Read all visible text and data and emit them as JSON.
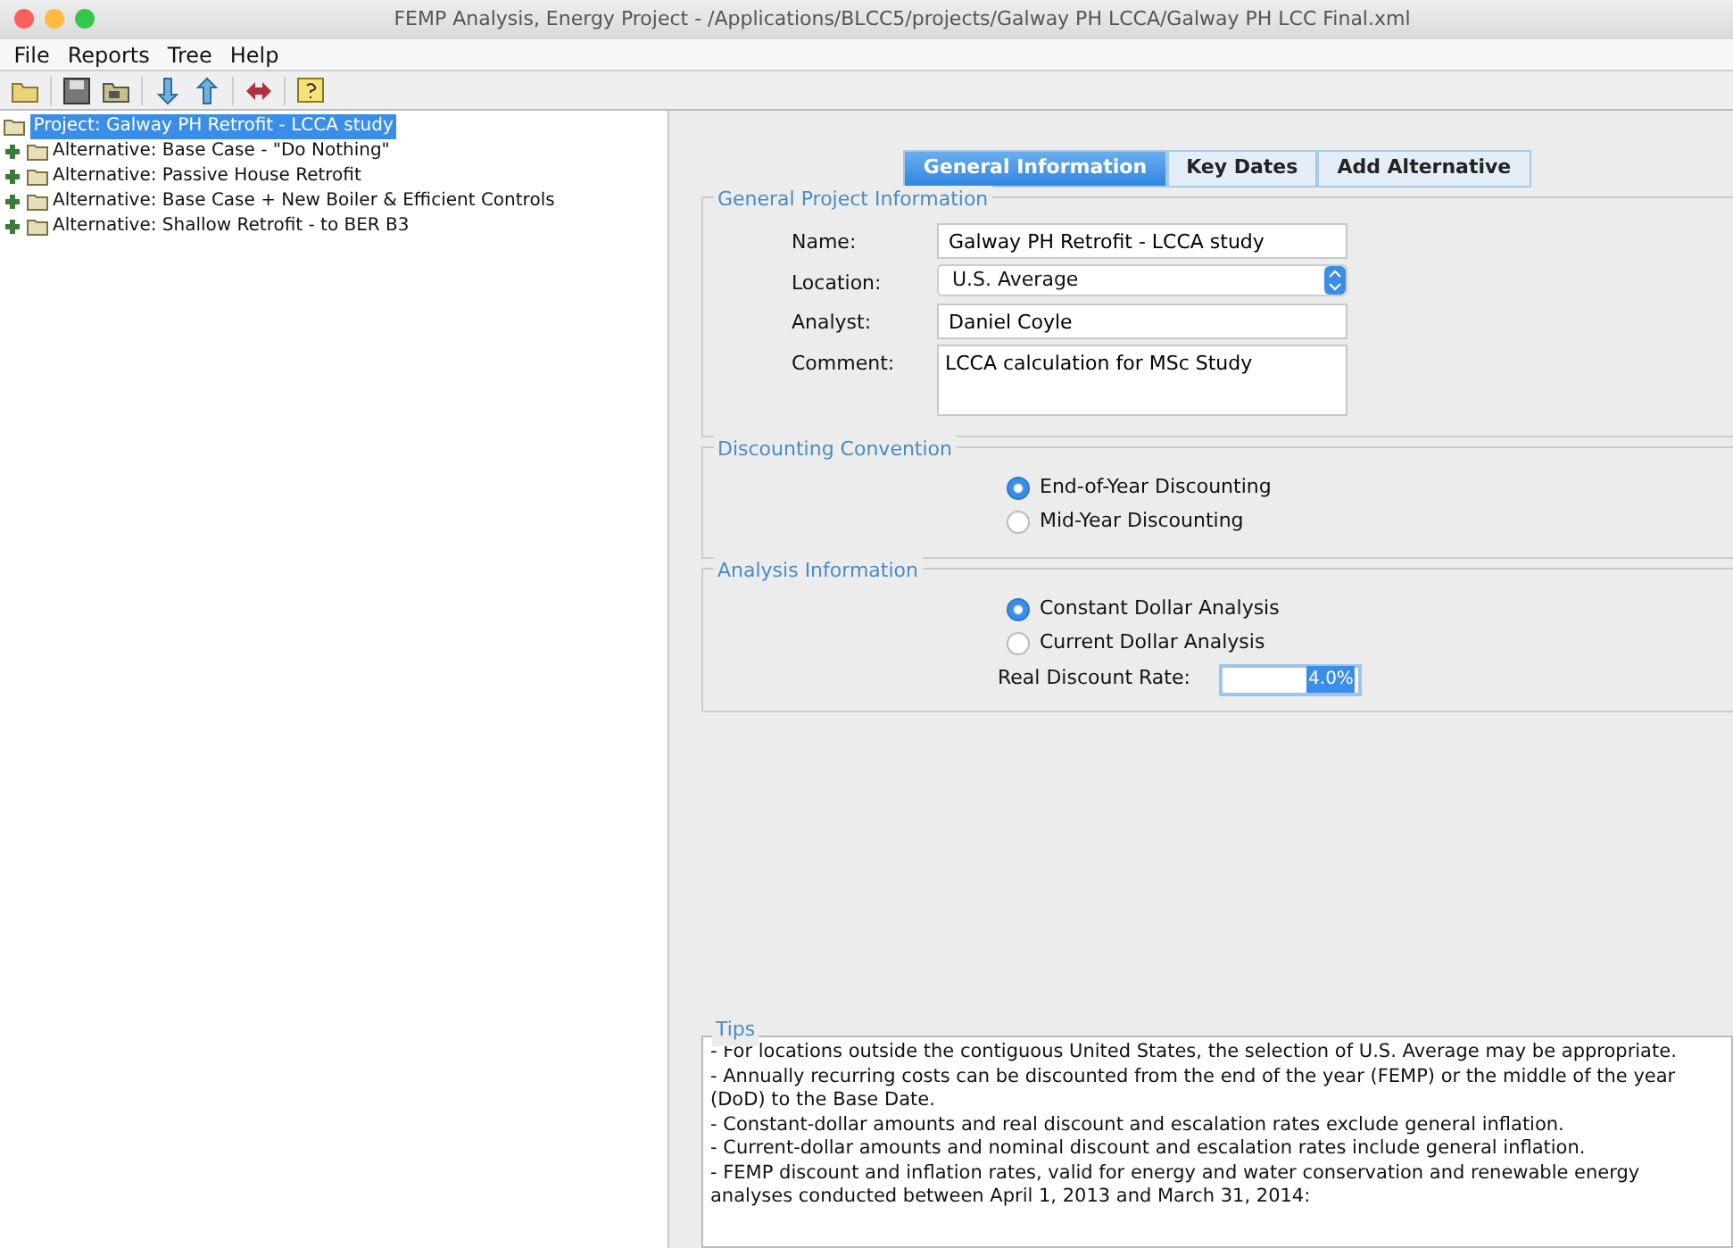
{
  "window": {
    "title": "FEMP Analysis, Energy Project - /Applications/BLCC5/projects/Galway PH LCCA/Galway PH LCC Final.xml"
  },
  "menu": [
    "File",
    "Reports",
    "Tree",
    "Help"
  ],
  "tree": {
    "label": "Project: Galway PH Retrofit - LCCA study",
    "selected": true,
    "children": [
      {
        "label": "Alternative: Base Case - \"Do Nothing\"",
        "selected": false,
        "expanded": false
      },
      {
        "label": "Alternative: Passive House Retrofit",
        "selected": false,
        "expanded": false
      },
      {
        "label": "Alternative: Base Case + New Boiler & Efficient Controls",
        "selected": false,
        "expanded": false
      },
      {
        "label": "Alternative: Shallow Retrofit - to BER B3",
        "selected": false,
        "expanded": false
      }
    ]
  },
  "tabs": [
    {
      "label": "General Information",
      "selected": true
    },
    {
      "label": "Key Dates",
      "selected": false
    },
    {
      "label": "Add Alternative",
      "selected": false
    }
  ],
  "general": {
    "title": "General Project Information",
    "fields": [
      {
        "kind": "text",
        "label": "Name:",
        "value": "Galway PH Retrofit - LCCA study"
      },
      {
        "kind": "select",
        "label": "Location:",
        "value": "U.S. Average"
      },
      {
        "kind": "text",
        "label": "Analyst:",
        "value": "Daniel Coyle"
      },
      {
        "kind": "textarea",
        "label": "Comment:",
        "value": "LCCA calculation for MSc Study"
      }
    ]
  },
  "discounting": {
    "title": "Discounting Convention",
    "options": [
      {
        "label": "End-of-Year Discounting",
        "selected": true
      },
      {
        "label": "Mid-Year Discounting",
        "selected": false
      }
    ]
  },
  "analysis": {
    "title": "Analysis Information",
    "options": [
      {
        "label": "Constant Dollar Analysis",
        "selected": true
      },
      {
        "label": "Current Dollar Analysis",
        "selected": false
      }
    ],
    "rate_label": "Real Discount Rate:",
    "rate_value": "4.0%"
  },
  "tips": {
    "title": "Tips",
    "lines": [
      "- For locations outside the contiguous United States, the selection of U.S. Average may be appropriate.",
      "- Annually recurring costs can be discounted from the end of the year (FEMP) or the middle of the year (DoD) to the Base Date.",
      "- Constant-dollar amounts and real discount and escalation rates exclude general inflation.",
      "- Current-dollar amounts and nominal discount and escalation rates include general inflation.",
      "- FEMP discount and inflation rates, valid for energy and water conservation and renewable energy analyses conducted between April 1, 2013 and March 31, 2014:"
    ]
  }
}
